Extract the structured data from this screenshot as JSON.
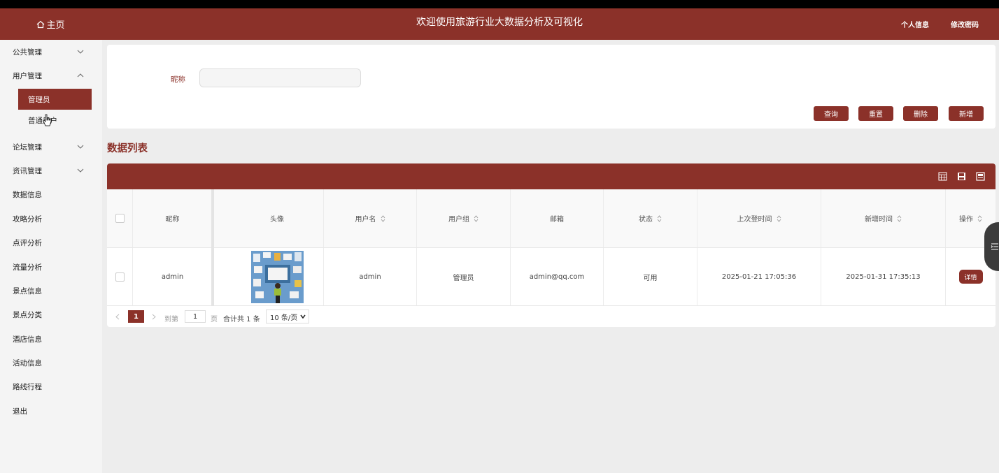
{
  "header": {
    "home_label": "主页",
    "title": "欢迎使用旅游行业大数据分析及可视化",
    "profile_label": "个人信息",
    "password_label": "修改密码"
  },
  "sidebar": {
    "items": [
      {
        "label": "公共管理"
      },
      {
        "label": "用户管理"
      },
      {
        "label": "论坛管理"
      },
      {
        "label": "资讯管理"
      },
      {
        "label": "数据信息"
      },
      {
        "label": "攻略分析"
      },
      {
        "label": "点评分析"
      },
      {
        "label": "流量分析"
      },
      {
        "label": "景点信息"
      },
      {
        "label": "景点分类"
      },
      {
        "label": "酒店信息"
      },
      {
        "label": "活动信息"
      },
      {
        "label": "路线行程"
      },
      {
        "label": "退出"
      }
    ],
    "subitems": [
      {
        "label": "管理员"
      },
      {
        "label": "普通用户"
      }
    ]
  },
  "search": {
    "label": "昵称",
    "value": "",
    "placeholder": "",
    "buttons": {
      "query": "查询",
      "reset": "重置",
      "delete": "删除",
      "add": "新增"
    }
  },
  "list": {
    "title": "数据列表",
    "columns": {
      "nickname": "昵称",
      "avatar": "头像",
      "username": "用户名",
      "group": "用户组",
      "email": "邮箱",
      "status": "状态",
      "last_login": "上次登时间",
      "created": "新增时间",
      "actions": "操作"
    },
    "rows": [
      {
        "nickname": "admin",
        "username": "admin",
        "group": "管理员",
        "email": "admin@qq.com",
        "status": "可用",
        "last_login": "2025-01-21 17:05:36",
        "created": "2025-01-31 17:35:13",
        "action": "详情"
      }
    ]
  },
  "pager": {
    "current": "1",
    "goto_label": "到第",
    "page_input": "1",
    "page_unit": "页",
    "total": "合计共 1 条",
    "per_page": "10 条/页"
  },
  "colors": {
    "accent": "#8b3129"
  }
}
